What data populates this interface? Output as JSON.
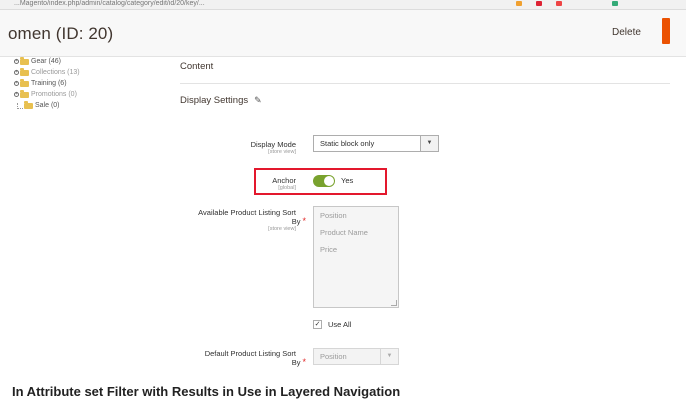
{
  "browser": {
    "url_fragment": "...Magento/index.php/admin/catalog/category/edit/id/20/key/..."
  },
  "header": {
    "title": "omen (ID: 20)",
    "delete_label": "Delete",
    "accent_color": "#eb5202"
  },
  "tree": {
    "items": [
      {
        "label": "Gear (46)",
        "dim": false,
        "icon": "folder-icon"
      },
      {
        "label": "Collections (13)",
        "dim": true,
        "icon": "folder-icon"
      },
      {
        "label": "Training (6)",
        "dim": false,
        "icon": "folder-icon"
      },
      {
        "label": "Promotions (0)",
        "dim": true,
        "icon": "folder-icon"
      },
      {
        "label": "Sale (0)",
        "dim": false,
        "icon": "folder-icon"
      }
    ]
  },
  "sections": {
    "content": "Content",
    "display_settings": "Display Settings",
    "edit_icon": "pencil-icon"
  },
  "form": {
    "display_mode": {
      "label": "Display Mode",
      "scope": "[store view]",
      "value": "Static block only"
    },
    "anchor": {
      "label": "Anchor",
      "scope": "[global]",
      "value_text": "Yes",
      "enabled": true,
      "toggle_color": "#79a22e",
      "highlight_color": "#e3182d"
    },
    "available_sort": {
      "label_line1": "Available Product Listing Sort",
      "label_line2": "By",
      "required_mark": "*",
      "scope": "[store view]",
      "options": [
        "Position",
        "Product Name",
        "Price"
      ],
      "use_all_label": "Use All",
      "use_all_checked": true
    },
    "default_sort": {
      "label_line1": "Default Product Listing Sort",
      "label_line2": "By",
      "required_mark": "*",
      "value": "Position"
    }
  },
  "bottom_heading": "In Attribute set Filter with Results in Use in Layered Navigation"
}
